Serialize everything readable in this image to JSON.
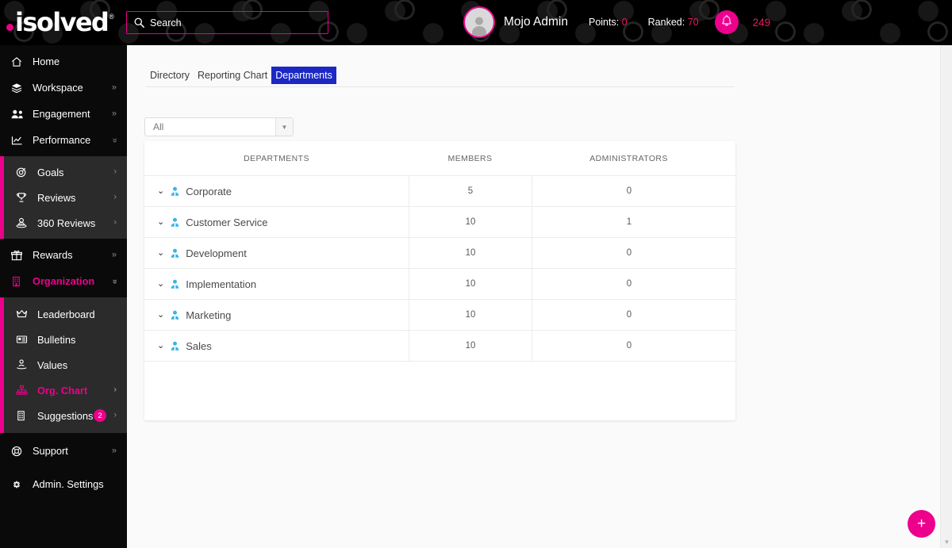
{
  "header": {
    "logo_text": "isolved",
    "logo_tm": "®",
    "search_placeholder": "Search",
    "user_name": "Mojo Admin",
    "points_label": "Points:",
    "points_value": "0",
    "ranked_label": "Ranked:",
    "ranked_value": "70",
    "notification_count": "249",
    "accent_color": "#ec008c"
  },
  "sidebar": {
    "groups": [
      {
        "type": "main",
        "items": [
          {
            "label": "Home",
            "icon": "home-icon",
            "arrow": ""
          },
          {
            "label": "Workspace",
            "icon": "layers-icon",
            "arrow": "»"
          },
          {
            "label": "Engagement",
            "icon": "people-icon",
            "arrow": "»"
          },
          {
            "label": "Performance",
            "icon": "chart-icon",
            "arrow": "»"
          }
        ]
      },
      {
        "type": "sub",
        "items": [
          {
            "label": "Goals",
            "icon": "target-icon",
            "arrow": "›"
          },
          {
            "label": "Reviews",
            "icon": "trophy-icon",
            "arrow": "›"
          },
          {
            "label": "360 Reviews",
            "icon": "person-360-icon",
            "arrow": "›"
          }
        ]
      },
      {
        "type": "main",
        "items": [
          {
            "label": "Rewards",
            "icon": "gift-icon",
            "arrow": "»"
          },
          {
            "label": "Organization",
            "icon": "building-icon",
            "arrow": "»",
            "accent": true
          }
        ]
      },
      {
        "type": "sub",
        "items": [
          {
            "label": "Leaderboard",
            "icon": "crown-icon",
            "arrow": ""
          },
          {
            "label": "Bulletins",
            "icon": "bulletin-icon",
            "arrow": ""
          },
          {
            "label": "Values",
            "icon": "values-icon",
            "arrow": ""
          },
          {
            "label": "Org. Chart",
            "icon": "org-chart-icon",
            "arrow": "›",
            "accent": true
          },
          {
            "label": "Suggestions",
            "icon": "suggestions-icon",
            "arrow": "›",
            "badge": "2"
          }
        ]
      },
      {
        "type": "main",
        "items": [
          {
            "label": "Support",
            "icon": "lifebuoy-icon",
            "arrow": "»"
          },
          {
            "label": "Admin. Settings",
            "icon": "gear-icon",
            "arrow": ""
          }
        ]
      }
    ]
  },
  "main": {
    "tabs": [
      {
        "label": "Directory",
        "active": false
      },
      {
        "label": "Reporting Chart",
        "active": false
      },
      {
        "label": "Departments",
        "active": true
      }
    ],
    "filter": {
      "value": "All",
      "caret": "▼"
    },
    "table": {
      "headers": [
        "DEPARTMENTS",
        "MEMBERS",
        "ADMINISTRATORS"
      ],
      "rows": [
        {
          "name": "Corporate",
          "members": "5",
          "administrators": "0"
        },
        {
          "name": "Customer Service",
          "members": "10",
          "administrators": "1"
        },
        {
          "name": "Development",
          "members": "10",
          "administrators": "0"
        },
        {
          "name": "Implementation",
          "members": "10",
          "administrators": "0"
        },
        {
          "name": "Marketing",
          "members": "10",
          "administrators": "0"
        },
        {
          "name": "Sales",
          "members": "10",
          "administrators": "0"
        }
      ],
      "row_chevron": "⌄"
    },
    "fab_label": "+"
  },
  "scrollbar": {
    "down_arrow": "▼"
  }
}
